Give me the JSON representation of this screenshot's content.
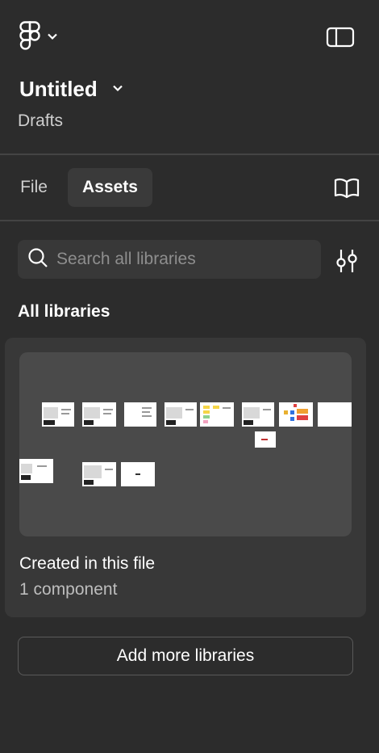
{
  "header": {
    "logo_icon": "figma-logo-icon",
    "logo_menu_icon": "chevron-down-icon",
    "sidebar_toggle_icon": "sidebar-panel-icon"
  },
  "file": {
    "title": "Untitled",
    "title_menu_icon": "chevron-down-icon",
    "location": "Drafts"
  },
  "tabs": [
    {
      "label": "File",
      "active": false
    },
    {
      "label": "Assets",
      "active": true
    }
  ],
  "book_icon": "book-open-icon",
  "search": {
    "placeholder": "Search all libraries",
    "value": "",
    "icon": "search-icon",
    "filter_icon": "sliders-icon"
  },
  "libraries": {
    "section_title": "All libraries",
    "items": [
      {
        "name": "Created in this file",
        "count": "1 component"
      }
    ]
  },
  "add_button": {
    "label": "Add more libraries"
  },
  "colors": {
    "background": "#2c2c2c",
    "card": "#383838",
    "thumbnail": "#4a4a4a",
    "divider": "#444444",
    "text_primary": "#ffffff",
    "text_secondary": "#cfcfcf"
  }
}
